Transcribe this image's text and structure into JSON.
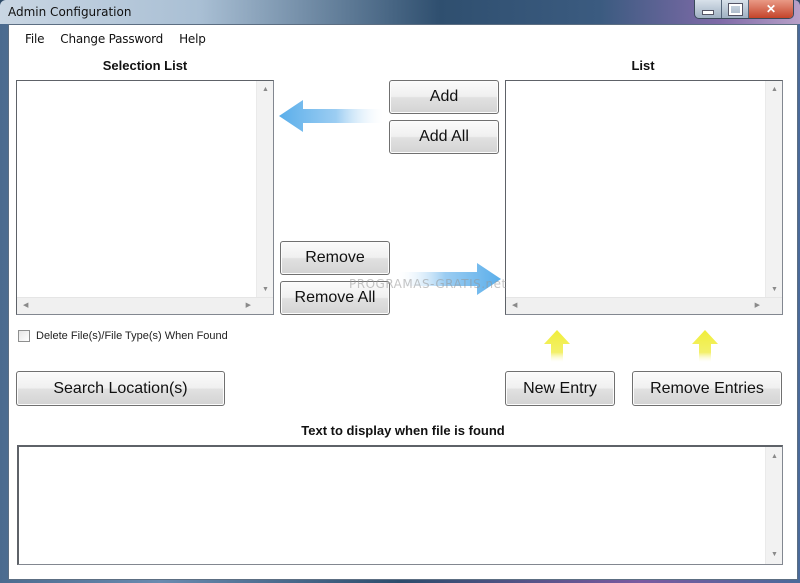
{
  "window": {
    "title": "Admin Configuration",
    "caption_buttons": {
      "minimize": "minimize",
      "maximize": "maximize",
      "close": "✕"
    }
  },
  "menu": {
    "items": [
      {
        "label": "File"
      },
      {
        "label": "Change Password"
      },
      {
        "label": "Help"
      }
    ]
  },
  "selection_list": {
    "heading": "Selection List",
    "items": []
  },
  "list": {
    "heading": "List",
    "items": []
  },
  "buttons": {
    "add": "Add",
    "add_all": "Add All",
    "remove": "Remove",
    "remove_all": "Remove All",
    "search_locations": "Search Location(s)",
    "new_entry": "New Entry",
    "remove_entries": "Remove Entries"
  },
  "options": {
    "delete_when_found": {
      "label": "Delete File(s)/File Type(s) When Found",
      "checked": false
    }
  },
  "display_text": {
    "heading": "Text to display when file is found",
    "value": ""
  },
  "watermark": "PROGRAMAS-GRATIS.net",
  "colors": {
    "blue_arrow": "#5aaeea",
    "yellow_arrow": "#f0ee3a",
    "close_button": "#c4442a"
  }
}
